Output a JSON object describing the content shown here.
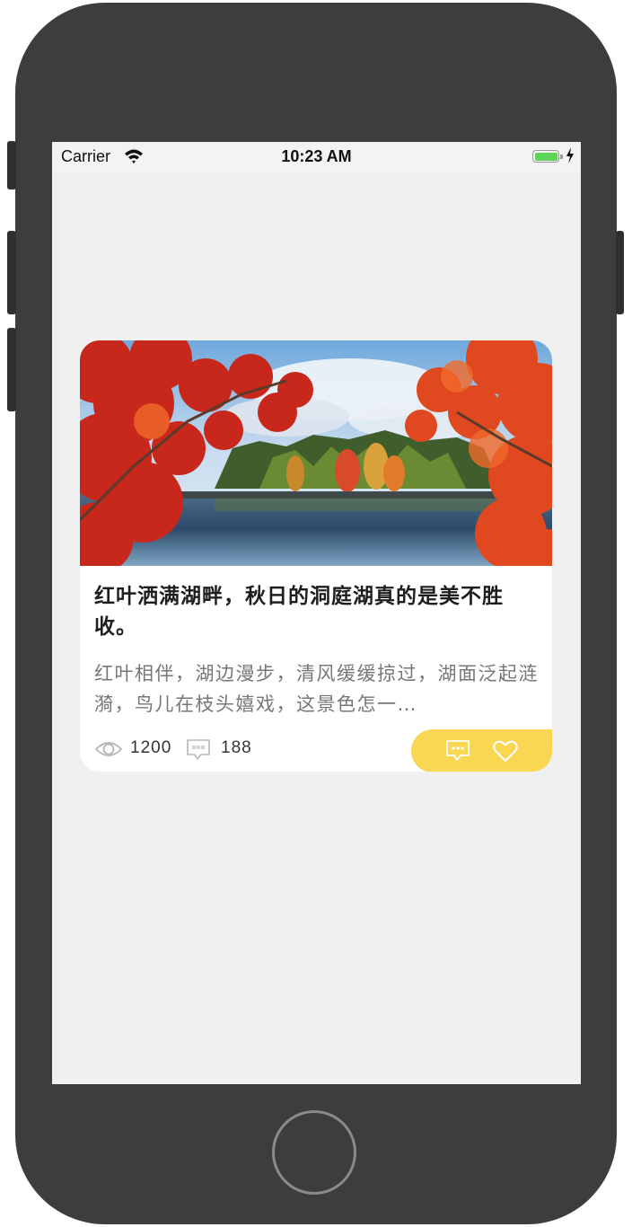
{
  "status_bar": {
    "carrier": "Carrier",
    "time": "10:23 AM",
    "icons": [
      "wifi-icon",
      "battery-icon",
      "charging-bolt-icon"
    ]
  },
  "card": {
    "image": "autumn-lake-red-maple-photo",
    "title": "红叶洒满湖畔，秋日的洞庭湖真的是美不胜收。",
    "description": "红叶相伴，湖边漫步，清风缓缓掠过，湖面泛起涟漪，鸟儿在枝头嬉戏，这景色怎一…",
    "views": "1200",
    "comments": "188",
    "icons": [
      "eye-icon",
      "comment-bubble-icon",
      "comment-action-icon",
      "heart-icon"
    ]
  },
  "colors": {
    "action_pill": "#f9d752",
    "screen_bg": "#f0f0f0",
    "phone_body": "#3d3d3d"
  }
}
